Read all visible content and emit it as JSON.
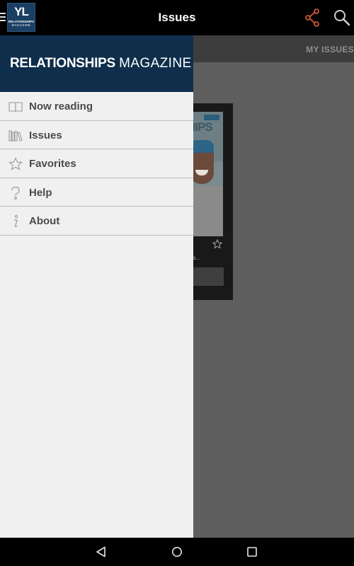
{
  "topbar": {
    "title": "Issues",
    "logo": {
      "mark": "YL",
      "line1": "RELATIONSHIPS",
      "line2": "MAGAZINE"
    },
    "icons": [
      "menu-icon",
      "share-icon",
      "search-icon"
    ],
    "share_color": "#e8603c"
  },
  "tabs": {
    "my_issues": "MY ISSUES"
  },
  "issue_card": {
    "cover_word": "HIPS",
    "caption": "a..."
  },
  "drawer": {
    "brand_bold": "RELATIONSHIPS",
    "brand_light": "MAGAZINE",
    "header_color": "#0f2e4b",
    "items": [
      {
        "label": "Now reading",
        "icon": "book-icon"
      },
      {
        "label": "Issues",
        "icon": "bookshelf-icon"
      },
      {
        "label": "Favorites",
        "icon": "star-icon"
      },
      {
        "label": "Help",
        "icon": "question-icon"
      },
      {
        "label": "About",
        "icon": "info-icon"
      }
    ]
  },
  "navbar": {
    "icons": [
      "back-icon",
      "home-icon",
      "recents-icon"
    ]
  }
}
